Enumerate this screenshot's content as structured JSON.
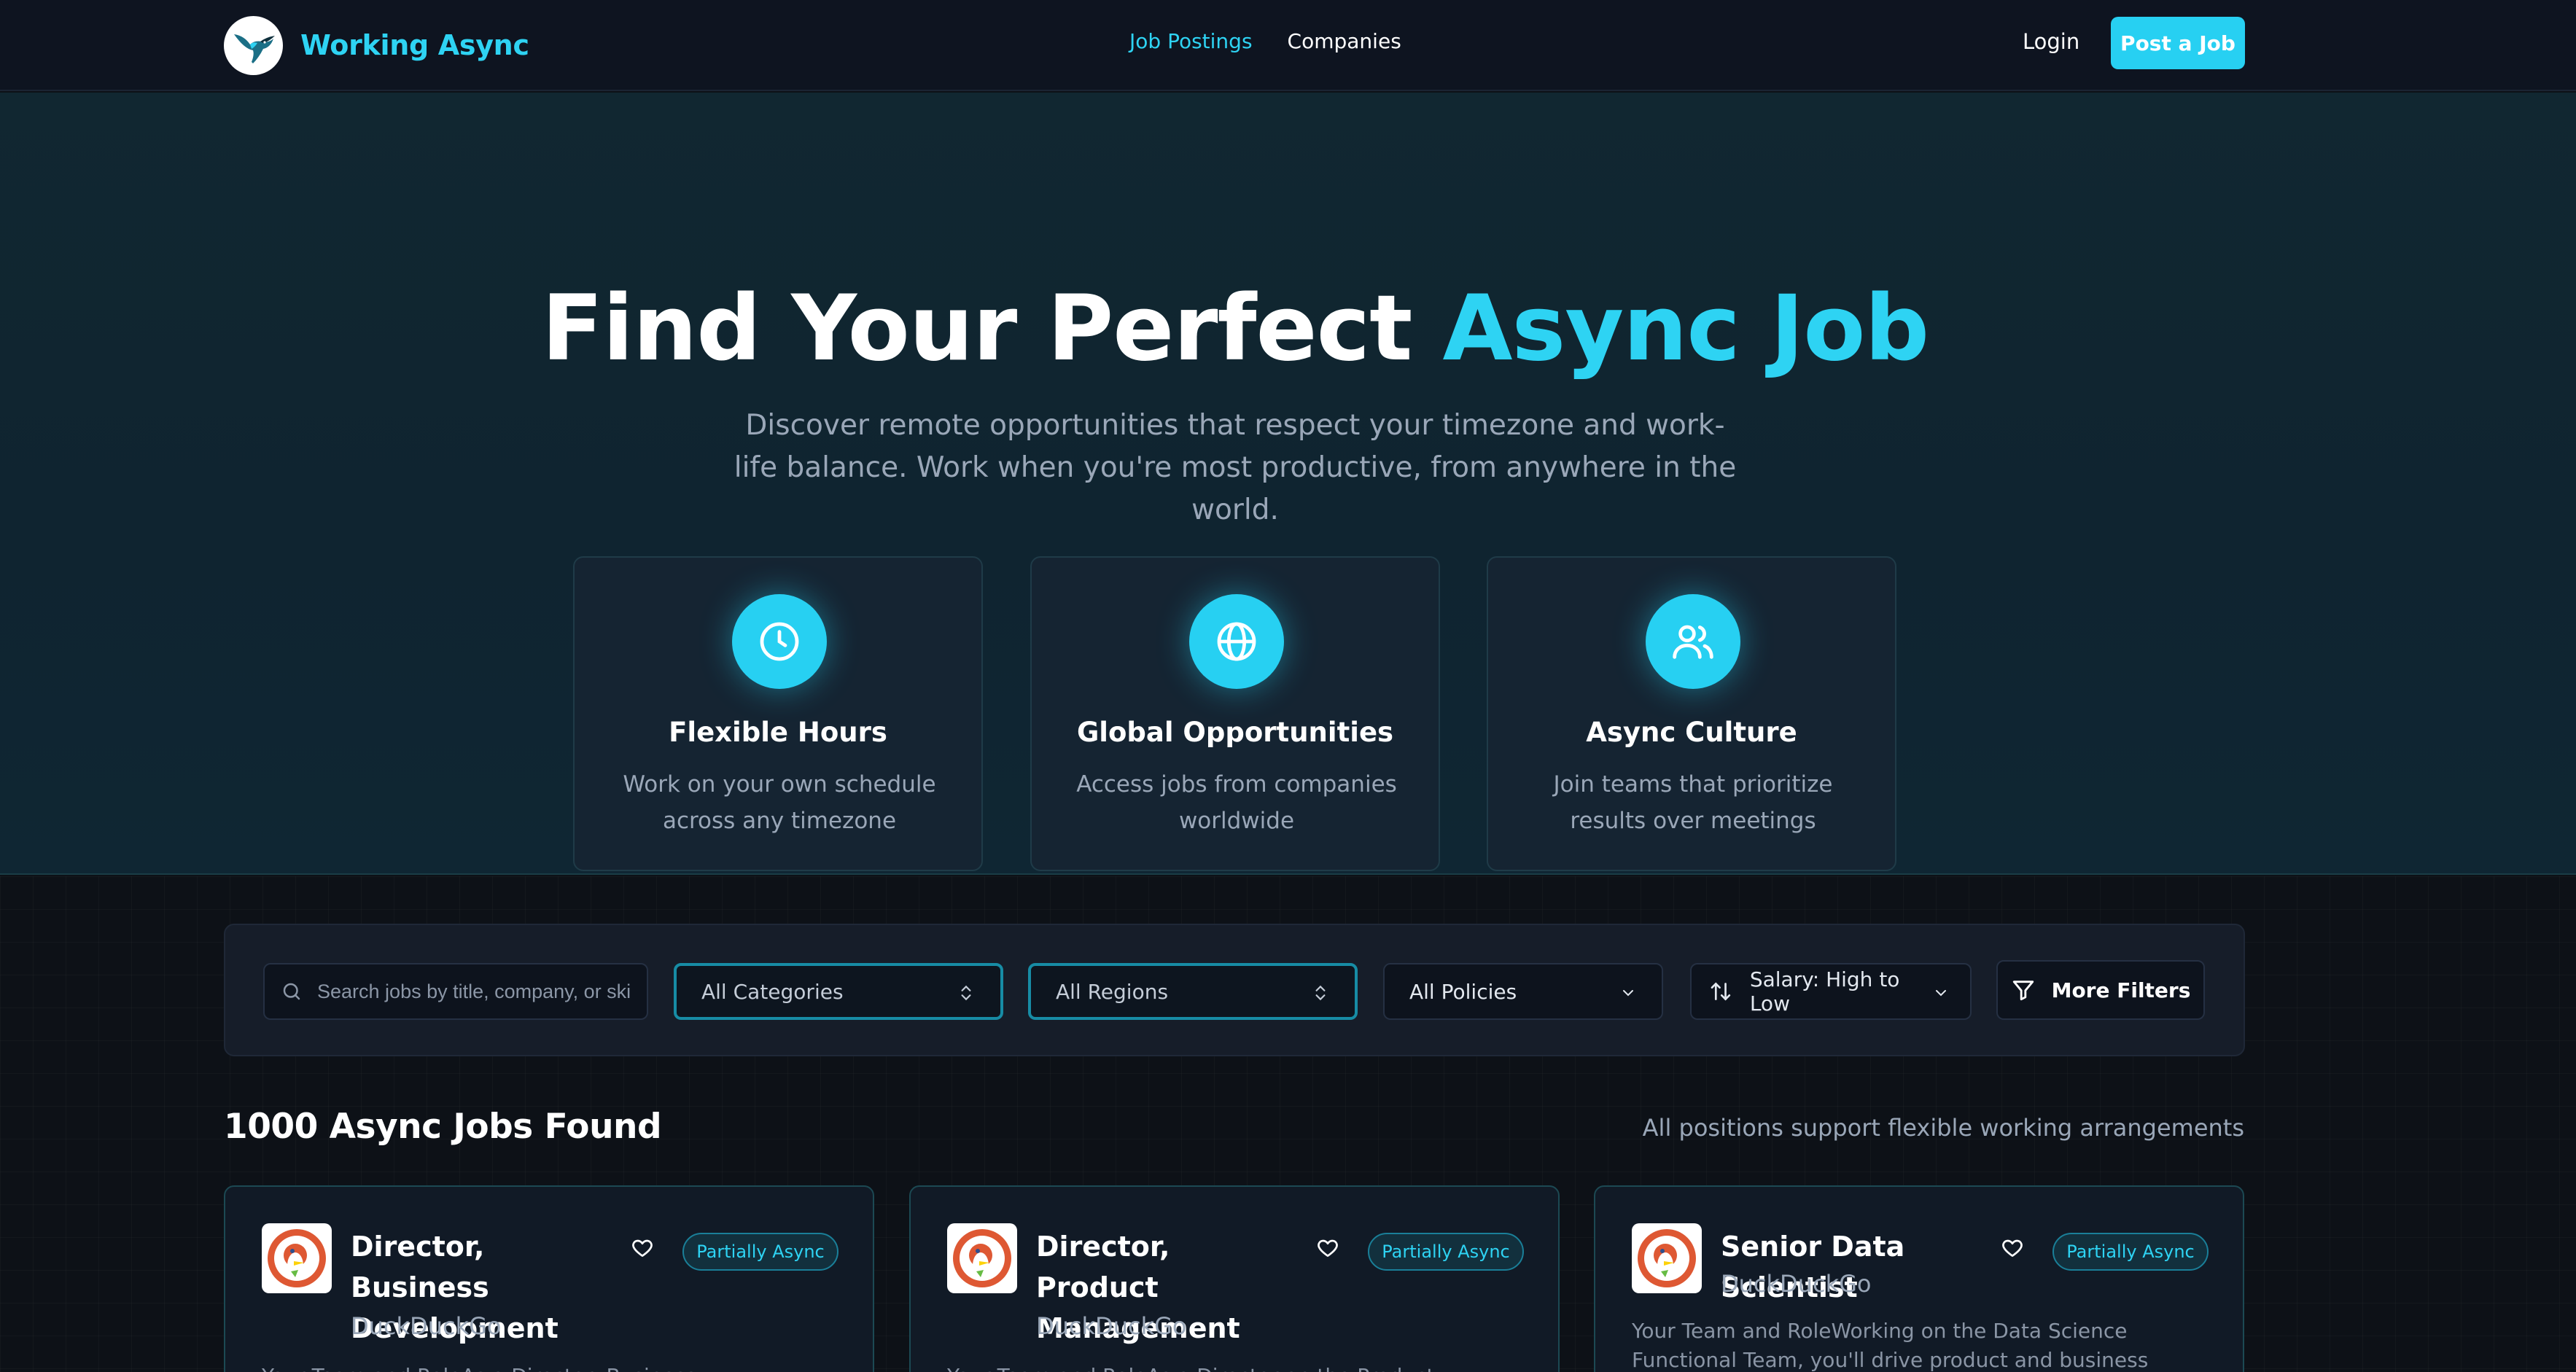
{
  "nav": {
    "brand": "Working Async",
    "links": [
      "Job Postings",
      "Companies"
    ],
    "login": "Login",
    "post_job": "Post a Job"
  },
  "hero": {
    "title_main": "Find Your Perfect",
    "title_accent": "Async Job",
    "subtitle": "Discover remote opportunities that respect your timezone and work-life balance. Work when you're most productive, from anywhere in the world.",
    "features": [
      {
        "icon": "clock-icon",
        "title": "Flexible Hours",
        "desc": "Work on your own schedule across any timezone"
      },
      {
        "icon": "globe-icon",
        "title": "Global Opportunities",
        "desc": "Access jobs from companies worldwide"
      },
      {
        "icon": "users-icon",
        "title": "Async Culture",
        "desc": "Join teams that prioritize results over meetings"
      }
    ]
  },
  "filters": {
    "search_placeholder": "Search jobs by title, company, or skills...",
    "category": "All Categories",
    "region": "All Regions",
    "policy": "All Policies",
    "sort": "Salary: High to Low",
    "more": "More Filters"
  },
  "results": {
    "count_label": "1000 Async Jobs Found",
    "note": "All positions support flexible working arrangements"
  },
  "jobs": [
    {
      "title": "Director, Business Development",
      "company": "DuckDuckGo",
      "badge": "Partially Async",
      "desc": "Your Team and RoleAs a Director, Business Development at DuckDuckGo, you'll..."
    },
    {
      "title": "Director, Product Management",
      "company": "DuckDuckGo",
      "badge": "Partially Async",
      "desc": "Your Team and RoleAs a Director on the Product Management team, you'll..."
    },
    {
      "title": "Senior Data Scientist",
      "company": "DuckDuckGo",
      "badge": "Partially Async",
      "desc": "Your Team and RoleWorking on the Data Science Functional Team, you'll drive product and business impact through..."
    }
  ],
  "colors": {
    "accent": "#27d0f2",
    "background": "#0d1117",
    "card": "#152432"
  }
}
